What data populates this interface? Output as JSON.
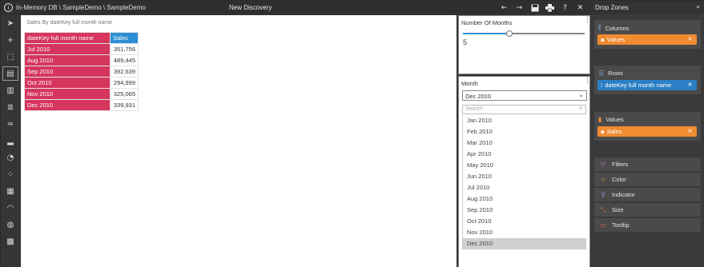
{
  "titlebar": {
    "path": "In-Memory DB \\ SampleDemo \\ SampleDemo",
    "title": "New Discovery"
  },
  "canvas": {
    "visual_title": "Sales By dateKey full month name",
    "table": {
      "row_header": "dateKey full month name",
      "col_header": "Sales",
      "rows": [
        {
          "label": "Jul 2010",
          "value": "351,756"
        },
        {
          "label": "Aug 2010",
          "value": "489,445"
        },
        {
          "label": "Sep 2010",
          "value": "392,639"
        },
        {
          "label": "Oct 2010",
          "value": "294,999"
        },
        {
          "label": "Nov 2010",
          "value": "325,065"
        },
        {
          "label": "Dec 2010",
          "value": "339,931"
        }
      ]
    }
  },
  "slider_filter": {
    "title": "Number Of Months",
    "value": "5",
    "fraction": 0.38
  },
  "month_filter": {
    "title": "Month",
    "selected": "Dec 2010",
    "search_placeholder": "Search",
    "options": [
      "Jan 2010",
      "Feb 2010",
      "Mar 2010",
      "Apr 2010",
      "May 2010",
      "Jun 2010",
      "Jul 2010",
      "Aug 2010",
      "Sep 2010",
      "Oct 2010",
      "Nov 2010",
      "Dec 2010"
    ]
  },
  "dropzones": {
    "header": "Drop Zones",
    "columns": {
      "label": "Columns",
      "chip": "Values"
    },
    "rows": {
      "label": "Rows",
      "chip": "dateKey full month name"
    },
    "values": {
      "label": "Values",
      "chip": "Sales"
    },
    "extras": [
      {
        "label": "Filters",
        "icon": "filter-icon"
      },
      {
        "label": "Color",
        "icon": "color-icon"
      },
      {
        "label": "Indicator",
        "icon": "indicator-icon"
      },
      {
        "label": "Size",
        "icon": "size-icon"
      },
      {
        "label": "Tooltip",
        "icon": "tooltip-icon"
      }
    ]
  },
  "colors": {
    "accent_pink": "#d6365e",
    "accent_blue": "#2d8fd3",
    "chip_orange": "#f08b31",
    "chip_blue": "#2b7fc4"
  }
}
